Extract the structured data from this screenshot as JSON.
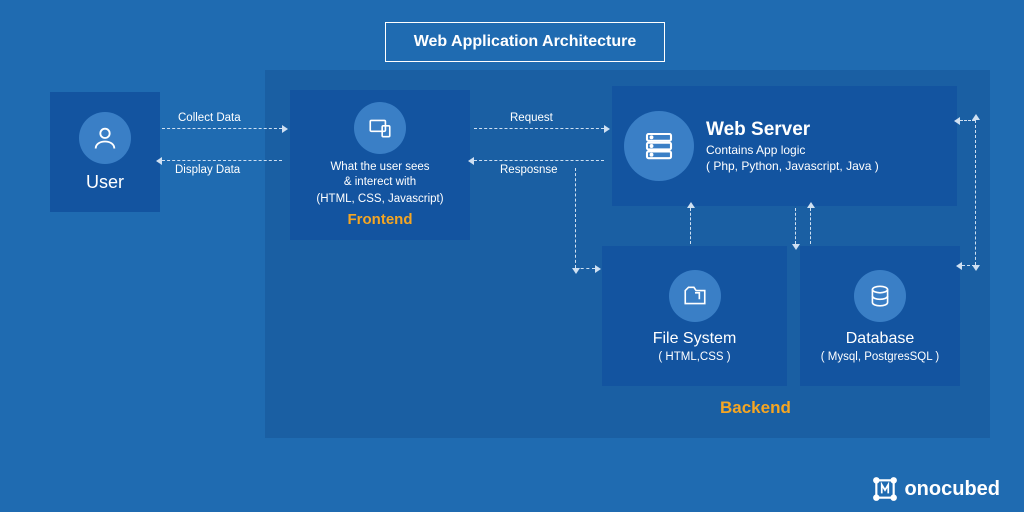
{
  "title": "Web  Application Architecture",
  "user": {
    "label": "User"
  },
  "edges": {
    "collect": "Collect Data",
    "display": "Display Data",
    "request": "Request",
    "response": "Resposnse"
  },
  "frontend": {
    "desc1": "What the user sees",
    "desc2": "& interect with",
    "tech": "(HTML, CSS, Javascript)",
    "label": "Frontend"
  },
  "webserver": {
    "title": "Web Server",
    "subtitle": "Contains App logic",
    "tech": "( Php, Python, Javascript, Java )"
  },
  "filesystem": {
    "title": "File System",
    "tech": "( HTML,CSS )"
  },
  "database": {
    "title": "Database",
    "tech": "( Mysql, PostgresSQL )"
  },
  "backend_label": "Backend",
  "brand": "onocubed"
}
